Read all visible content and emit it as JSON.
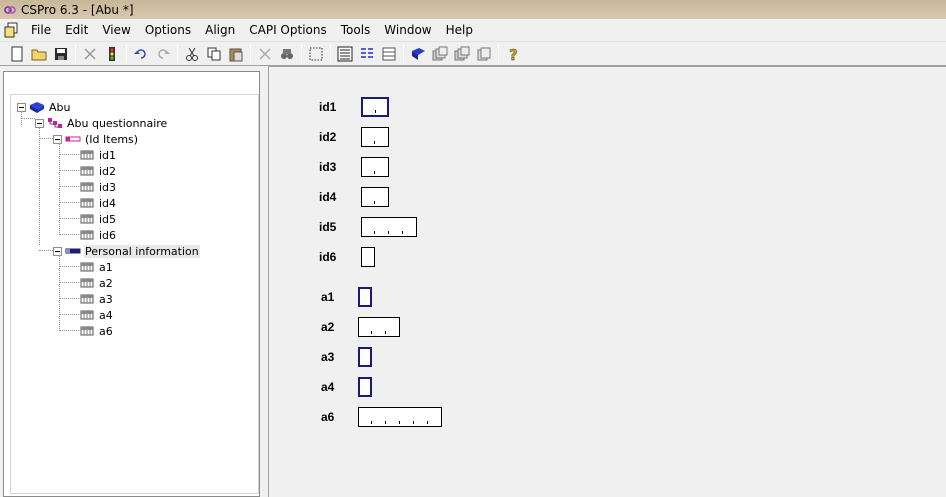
{
  "window": {
    "title": "CSPro 6.3 - [Abu *]"
  },
  "menu": [
    "File",
    "Edit",
    "View",
    "Options",
    "Align",
    "CAPI Options",
    "Tools",
    "Window",
    "Help"
  ],
  "toolbar": [
    {
      "name": "new-icon"
    },
    {
      "name": "open-icon"
    },
    {
      "name": "save-icon"
    },
    {
      "sep": true
    },
    {
      "name": "generate-icon"
    },
    {
      "name": "traffic-light-icon"
    },
    {
      "sep": true
    },
    {
      "name": "undo-icon"
    },
    {
      "name": "redo-icon"
    },
    {
      "sep": true
    },
    {
      "name": "cut-icon"
    },
    {
      "name": "copy-icon"
    },
    {
      "name": "paste-icon"
    },
    {
      "sep": true
    },
    {
      "name": "delete-icon"
    },
    {
      "name": "find-icon"
    },
    {
      "sep": true
    },
    {
      "name": "select-box-icon"
    },
    {
      "sep": true
    },
    {
      "name": "align-list-icon"
    },
    {
      "name": "align-columns-icon"
    },
    {
      "name": "align-rows-icon"
    },
    {
      "sep": true
    },
    {
      "name": "dictionary-icon"
    },
    {
      "name": "forms-stack-icon"
    },
    {
      "name": "forms-stack2-icon"
    },
    {
      "name": "forms-stack3-icon"
    },
    {
      "sep": true
    },
    {
      "name": "help-icon"
    }
  ],
  "tree": {
    "root": "Abu",
    "questionnaire": "Abu questionnaire",
    "groups": [
      {
        "label": "(Id Items)",
        "items": [
          "id1",
          "id2",
          "id3",
          "id4",
          "id5",
          "id6"
        ]
      },
      {
        "label": "Personal information",
        "items": [
          "a1",
          "a2",
          "a3",
          "a4",
          "a6"
        ]
      }
    ]
  },
  "form_fields": [
    {
      "label": "id1",
      "width": 1,
      "active": true
    },
    {
      "label": "id2",
      "width": 1,
      "active": false
    },
    {
      "label": "id3",
      "width": 1,
      "active": false
    },
    {
      "label": "id4",
      "width": 1,
      "active": false
    },
    {
      "label": "id5",
      "width": 2,
      "active": false
    },
    {
      "label": "id6",
      "width": 0,
      "active": false
    },
    {
      "label": "a1",
      "width": 0,
      "active": true
    },
    {
      "label": "a2",
      "width": 2,
      "active": false
    },
    {
      "label": "a3",
      "width": 0,
      "active": true
    },
    {
      "label": "a4",
      "width": 0,
      "active": true
    },
    {
      "label": "a6",
      "width": 3,
      "active": false
    }
  ]
}
